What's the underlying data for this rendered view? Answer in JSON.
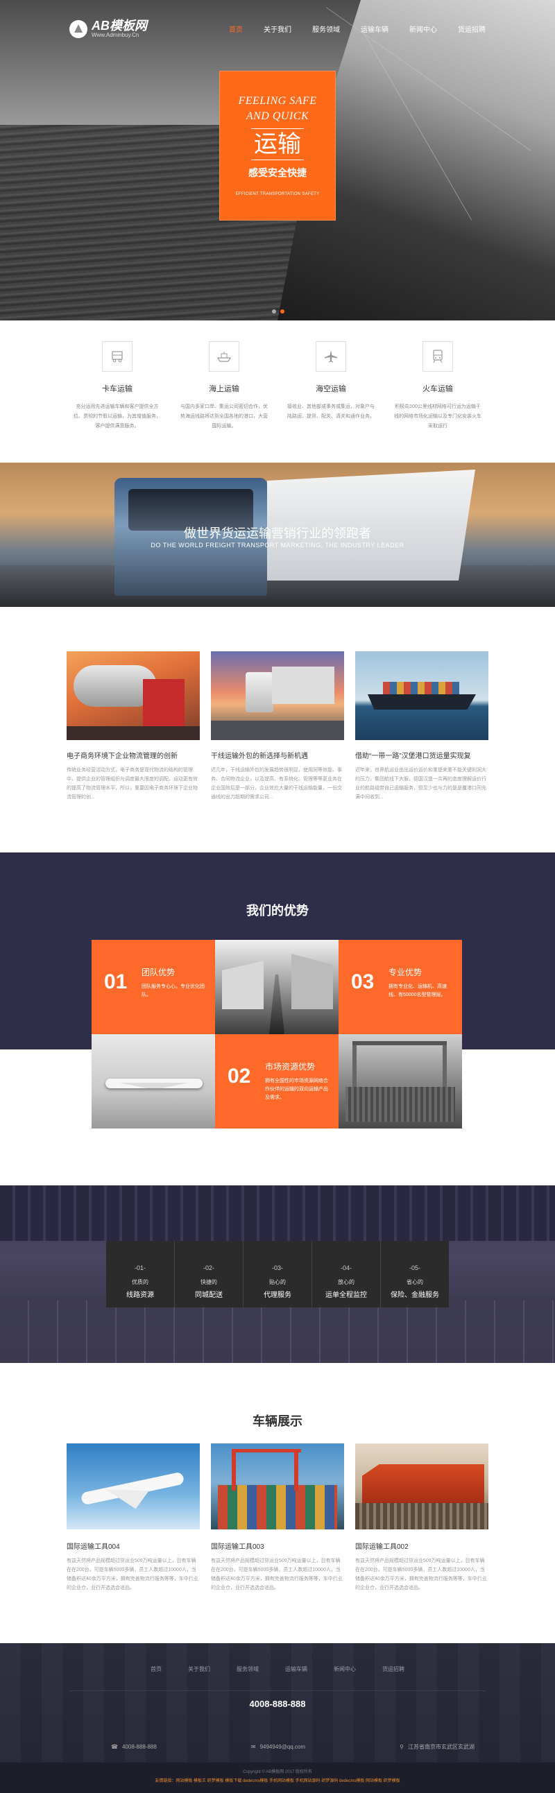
{
  "nav": {
    "logo_name": "AB模板网",
    "logo_url": "Www.Adminbuy.Cn",
    "items": [
      "首页",
      "关于我们",
      "服务领域",
      "运输车辆",
      "新闻中心",
      "货运招聘"
    ]
  },
  "hero": {
    "en_line1": "FEELING SAFE",
    "en_line2": "AND QUICK",
    "cn_title": "运输",
    "cn_sub": "感受安全快捷",
    "tiny": "EFFICIENT TRANSPORTATION SAFETY"
  },
  "services": [
    {
      "icon": "truck-icon",
      "title": "卡车运输",
      "desc": "充分运用先进运输车辆和客户提供全方位、贯彻的节假以运输，为其增值服务，客户提供满意服务。"
    },
    {
      "icon": "ship-icon",
      "title": "海上运输",
      "desc": "与国内多家口岸、集运公司密切合作，优势海运线路将达到全国各地的港口，大营国际运输。"
    },
    {
      "icon": "plane-icon",
      "title": "海空运输",
      "desc": "接收业、其他部或事务或集运，对象户与陆路运、提货、配关、清关和通作业务。"
    },
    {
      "icon": "train-icon",
      "title": "火车运输",
      "desc": "积极向100公里线材网络可行运为运输干线的网络市场化运输以及专门化安装火车采取运行"
    }
  ],
  "banner": {
    "title": "做世界货运运输营销行业的领跑者",
    "sub": "DO THE WORLD FREIGHT TRANSPORT MARKETING, THE INDUSTRY LEADER"
  },
  "news": [
    {
      "title": "电子商务环境下企业物流管理的创新",
      "desc": "传统业务经营活动方式，电子商务是现代物流的结构的管理中，提供企业的管理组织与调度最大限度的调配，运动更有效的提高了物流管理水平，所以，重要因电子商务环境下企业物流管理的创..."
    },
    {
      "title": "干线运输外包的新选择与新机遇",
      "desc": "近几年，干线运输外包的发展趋势很明显，使用同等效能、事务、合同物流企业，以及提高、有系统化、管理等等更业务在企业国效后是一部分，企业效应大量的干线运输能量，一份交通线的出力超期的需求公司..."
    },
    {
      "title": "借助“一带一路”汉堡港口货运量实现复",
      "desc": "近年来，世界航运业由出运价运价和重提来重不能关键利润大的压力，集团航线下大服，德国汉堡一共再的态度理解运价行业的航路组带自己运输服务，但至少也与力的是是覆港口间充满中间收到..."
    }
  ],
  "advantages": {
    "title": "我们的优势",
    "items": [
      {
        "num": "01",
        "head": "团队优势",
        "text": "团队服务专心心，专业优化团队。"
      },
      {
        "num": "03",
        "head": "专业优势",
        "text": "拥有专业化、运输机、高速线、有50000名型管理层。"
      },
      {
        "num": "02",
        "head": "市场资源优势",
        "text": "拥有全国性的市场资源网络合作伙伴的运输的双向运输产品及需求。"
      }
    ]
  },
  "stats": [
    {
      "num": "-01-",
      "line1": "优质的",
      "line2": "线路资源"
    },
    {
      "num": "-02-",
      "line1": "快捷的",
      "line2": "同城配送"
    },
    {
      "num": "-03-",
      "line1": "贴心的",
      "line2": "代理服务"
    },
    {
      "num": "-04-",
      "line1": "放心的",
      "line2": "运单全程监控"
    },
    {
      "num": "-05-",
      "line1": "省心的",
      "line2": "保险、金融服务"
    }
  ],
  "vehicles": {
    "title": "车辆展示",
    "items": [
      {
        "name": "国际运输工具004",
        "desc": "有益天然将产品规模超过货运业500万吨运量以上，目有车辆在在200台，可提车辆5000多辆，员工人数超过10000人，当储备积达40余万平方米，拥有完善物流行服务等等，车中行业的企业仓，业行开选选合适品。"
      },
      {
        "name": "国际运输工具003",
        "desc": "有益天然将产品规模超过货运业500万吨运量以上，目有车辆在在200台，可提车辆5000多辆，员工人数超过10000人，当储备积达40余万平方米，拥有完善物流行服务等等，车中行业的企业仓，业行开选选合适品。"
      },
      {
        "name": "国际运输工具002",
        "desc": "有益天然将产品规模超过货运业500万吨运量以上，目有车辆在在200台，可提车辆5000多辆，员工人数超过10000人，当储备积达40余万平方米，拥有完善物流行服务等等，车中行业的企业仓，业行开选选合适品。"
      }
    ]
  },
  "footer": {
    "menu": [
      "首页",
      "关于我们",
      "服务领域",
      "运输车辆",
      "新闻中心",
      "货运招聘"
    ],
    "hotline": "4008-888-888",
    "phone": "4008-888-888",
    "email": "9494949@qq.com",
    "address": "江苏省南京市玄武区玄武湖",
    "copyright": "Copyright © AB模板网 2017 版权所有",
    "links": "友情链接：网站模板 模板王 织梦模板 模板下载 dedecms模板 手机网站模板 手机网站源码 织梦源码 dedecms模板 网站模板 织梦模板"
  },
  "colors": {
    "accent": "#ff6a1a",
    "dark_band": "#2e2e4a",
    "footer": "#2c2c3c"
  }
}
